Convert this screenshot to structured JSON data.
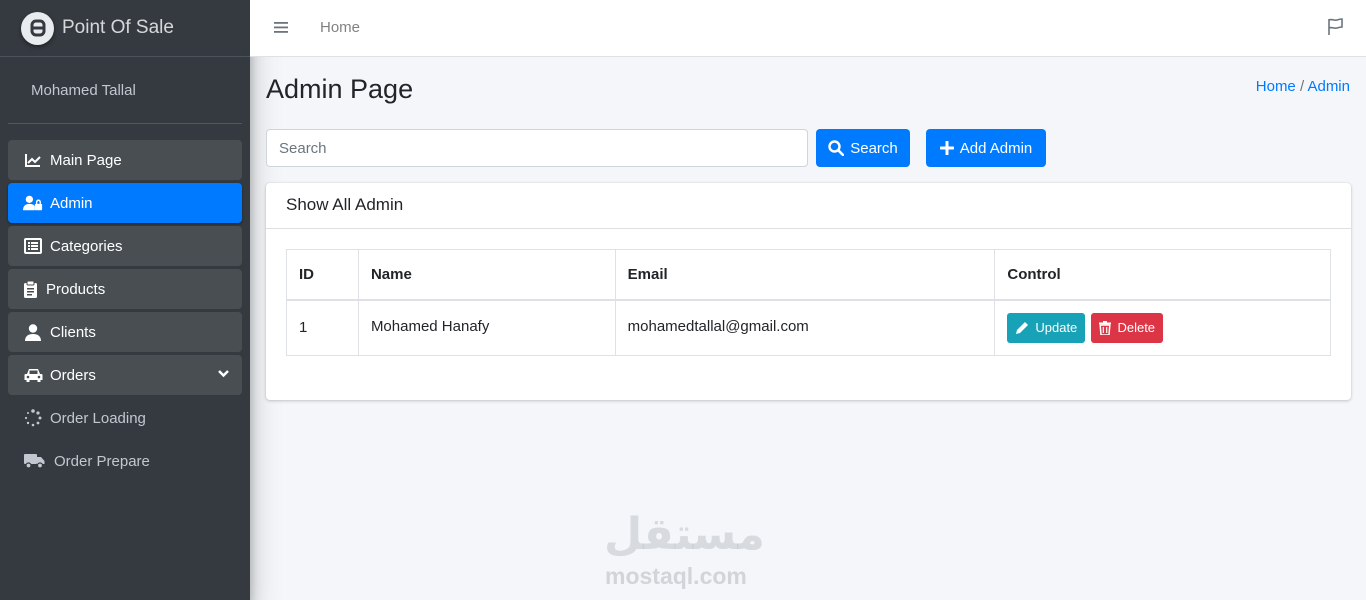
{
  "brand": {
    "name": "Point Of Sale"
  },
  "user": {
    "name": "Mohamed Tallal"
  },
  "sidebar": {
    "items": [
      {
        "label": "Main Page",
        "icon": "chart-line-icon"
      },
      {
        "label": "Admin",
        "icon": "user-lock-icon",
        "active": true
      },
      {
        "label": "Categories",
        "icon": "list-icon"
      },
      {
        "label": "Products",
        "icon": "clipboard-icon"
      },
      {
        "label": "Clients",
        "icon": "user-icon"
      },
      {
        "label": "Orders",
        "icon": "car-icon",
        "expandable": true
      },
      {
        "label": "Order Loading",
        "icon": "spinner-icon"
      },
      {
        "label": "Order Prepare",
        "icon": "truck-icon"
      }
    ]
  },
  "topbar": {
    "home_label": "Home"
  },
  "page": {
    "title": "Admin Page",
    "breadcrumb": {
      "home": "Home",
      "separator": "/",
      "current": "Admin"
    }
  },
  "search": {
    "placeholder": "Search",
    "button_label": "Search"
  },
  "add_admin": {
    "label": "Add Admin"
  },
  "card": {
    "title": "Show All Admin"
  },
  "table": {
    "headers": [
      "ID",
      "Name",
      "Email",
      "Control"
    ],
    "rows": [
      {
        "id": "1",
        "name": "Mohamed Hanafy",
        "email": "mohamedtallal@gmail.com",
        "update_label": "Update",
        "delete_label": "Delete"
      }
    ]
  },
  "watermark": {
    "arabic": "مستقل",
    "latin": "mostaql.com"
  },
  "colors": {
    "primary": "#007bff",
    "sidebar_bg": "#343a40",
    "info": "#17a2b8",
    "danger": "#dc3545"
  }
}
